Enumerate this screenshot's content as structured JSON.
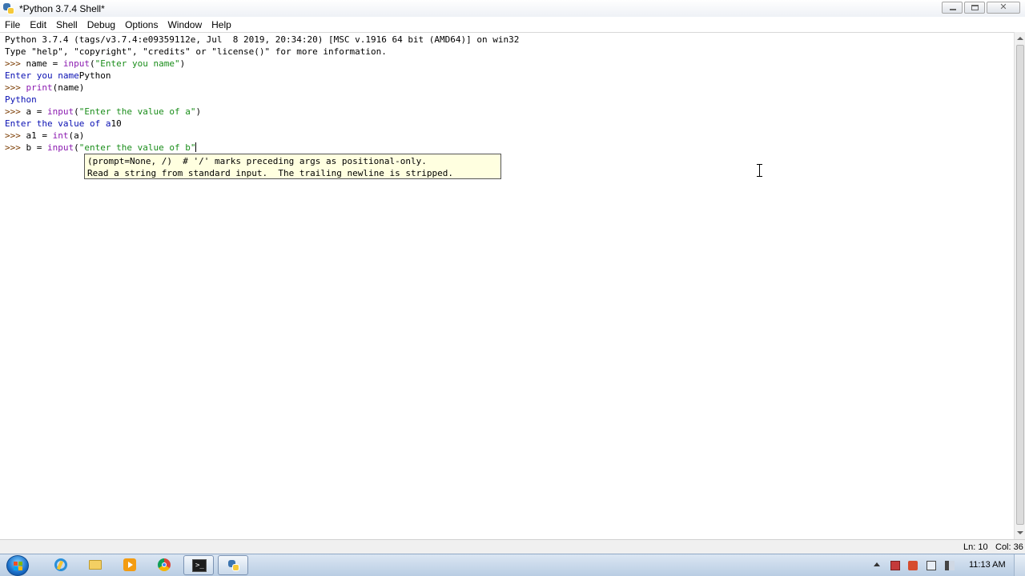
{
  "window": {
    "title": "*Python 3.7.4 Shell*"
  },
  "menu": {
    "items": [
      "File",
      "Edit",
      "Shell",
      "Debug",
      "Options",
      "Window",
      "Help"
    ]
  },
  "shell": {
    "banner1": "Python 3.7.4 (tags/v3.7.4:e09359112e, Jul  8 2019, 20:34:20) [MSC v.1916 64 bit (AMD64)] on win32",
    "banner2": "Type \"help\", \"copyright\", \"credits\" or \"license()\" for more information.",
    "prompt": ">>> ",
    "l3_code_a": "name = ",
    "l3_kw": "input",
    "l3_code_b": "(",
    "l3_str": "\"Enter you name\"",
    "l3_code_c": ")",
    "l4_out": "Enter you name",
    "l4_in": "Python",
    "l5_kw": "print",
    "l5_code": "(name)",
    "l6_out": "Python",
    "l7_code_a": "a = ",
    "l7_kw": "input",
    "l7_code_b": "(",
    "l7_str": "\"Enter the value of a\"",
    "l7_code_c": ")",
    "l8_out": "Enter the value of a",
    "l8_in": "10",
    "l9_code_a": "a1 = ",
    "l9_kw": "int",
    "l9_code_b": "(a)",
    "l10_code_a": "b = ",
    "l10_kw": "input",
    "l10_code_b": "(",
    "l10_str": "\"enter the value of b\""
  },
  "calltip": {
    "line1": "(prompt=None, /)  # '/' marks preceding args as positional-only.",
    "line2": "Read a string from standard input.  The trailing newline is stripped."
  },
  "status": {
    "ln": "Ln: 10",
    "col": "Col: 36"
  },
  "taskbar": {
    "clock": "11:13 AM"
  },
  "colors": {
    "prompt": "#7a3b00",
    "stdout": "#0a10b3",
    "builtin": "#8b1ab0",
    "string": "#1a8d1a",
    "calltip_bg": "#ffffe0"
  }
}
